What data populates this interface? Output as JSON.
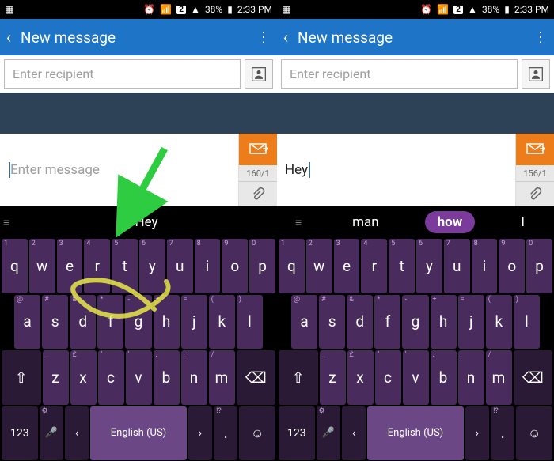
{
  "status": {
    "sim": "2",
    "battery": "38%",
    "time": "2:33 PM"
  },
  "header": {
    "title": "New message"
  },
  "recipient": {
    "placeholder": "Enter recipient"
  },
  "left": {
    "message_placeholder": "Enter message",
    "counter": "160/1",
    "suggestion_center": "Hey"
  },
  "right": {
    "message_text": "Hey ",
    "counter": "156/1",
    "suggestions": [
      "man",
      "how",
      "I"
    ]
  },
  "keys": {
    "row1": [
      {
        "m": "q",
        "s": "1"
      },
      {
        "m": "w",
        "s": "2"
      },
      {
        "m": "e",
        "s": "3"
      },
      {
        "m": "r",
        "s": "4"
      },
      {
        "m": "t",
        "s": "5"
      },
      {
        "m": "y",
        "s": "6"
      },
      {
        "m": "u",
        "s": "7"
      },
      {
        "m": "i",
        "s": "8"
      },
      {
        "m": "o",
        "s": "9"
      },
      {
        "m": "p",
        "s": "0"
      }
    ],
    "row2": [
      {
        "m": "a",
        "s": "@"
      },
      {
        "m": "s",
        "s": "#"
      },
      {
        "m": "d",
        "s": "&"
      },
      {
        "m": "f",
        "s": "*"
      },
      {
        "m": "g",
        "s": "-"
      },
      {
        "m": "h",
        "s": "+"
      },
      {
        "m": "j",
        "s": "="
      },
      {
        "m": "k",
        "s": "("
      },
      {
        "m": "l",
        "s": ")"
      }
    ],
    "row3": [
      {
        "m": "z",
        "s": "_"
      },
      {
        "m": "x",
        "s": "£"
      },
      {
        "m": "c",
        "s": "\""
      },
      {
        "m": "v",
        "s": "'"
      },
      {
        "m": "b",
        "s": ":"
      },
      {
        "m": "n",
        "s": ";"
      },
      {
        "m": "m",
        "s": "/"
      }
    ],
    "bottom": {
      "num": "123",
      "space": "English (US)",
      "period": ".",
      "period_sec": "!?"
    }
  }
}
